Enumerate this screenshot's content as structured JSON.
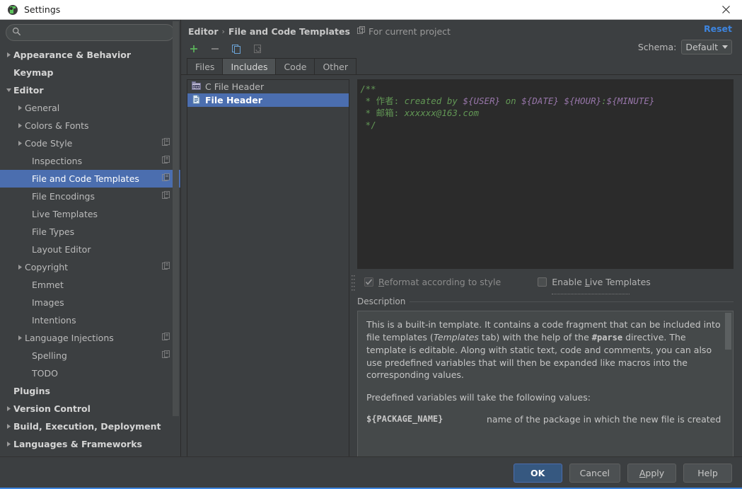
{
  "window": {
    "title": "Settings",
    "app_icon": "intellij-idea-icon",
    "close_icon": "close-icon"
  },
  "sidebar": {
    "search": {
      "value": "",
      "placeholder": "",
      "icon": "search-icon"
    },
    "items": [
      {
        "label": "Appearance & Behavior",
        "depth": 0,
        "arrow": "right",
        "bold": true,
        "copy": false,
        "selected": false
      },
      {
        "label": "Keymap",
        "depth": 0,
        "arrow": "none",
        "bold": true,
        "copy": false,
        "selected": false
      },
      {
        "label": "Editor",
        "depth": 0,
        "arrow": "down",
        "bold": true,
        "copy": false,
        "selected": false
      },
      {
        "label": "General",
        "depth": 1,
        "arrow": "right",
        "bold": false,
        "copy": false,
        "selected": false
      },
      {
        "label": "Colors & Fonts",
        "depth": 1,
        "arrow": "right",
        "bold": false,
        "copy": false,
        "selected": false
      },
      {
        "label": "Code Style",
        "depth": 1,
        "arrow": "right",
        "bold": false,
        "copy": true,
        "selected": false
      },
      {
        "label": "Inspections",
        "depth": 2,
        "arrow": "none",
        "bold": false,
        "copy": true,
        "selected": false
      },
      {
        "label": "File and Code Templates",
        "depth": 2,
        "arrow": "none",
        "bold": false,
        "copy": true,
        "selected": true
      },
      {
        "label": "File Encodings",
        "depth": 2,
        "arrow": "none",
        "bold": false,
        "copy": true,
        "selected": false
      },
      {
        "label": "Live Templates",
        "depth": 2,
        "arrow": "none",
        "bold": false,
        "copy": false,
        "selected": false
      },
      {
        "label": "File Types",
        "depth": 2,
        "arrow": "none",
        "bold": false,
        "copy": false,
        "selected": false
      },
      {
        "label": "Layout Editor",
        "depth": 2,
        "arrow": "none",
        "bold": false,
        "copy": false,
        "selected": false
      },
      {
        "label": "Copyright",
        "depth": 1,
        "arrow": "right",
        "bold": false,
        "copy": true,
        "selected": false
      },
      {
        "label": "Emmet",
        "depth": 2,
        "arrow": "none",
        "bold": false,
        "copy": false,
        "selected": false
      },
      {
        "label": "Images",
        "depth": 2,
        "arrow": "none",
        "bold": false,
        "copy": false,
        "selected": false
      },
      {
        "label": "Intentions",
        "depth": 2,
        "arrow": "none",
        "bold": false,
        "copy": false,
        "selected": false
      },
      {
        "label": "Language Injections",
        "depth": 1,
        "arrow": "right",
        "bold": false,
        "copy": true,
        "selected": false
      },
      {
        "label": "Spelling",
        "depth": 2,
        "arrow": "none",
        "bold": false,
        "copy": true,
        "selected": false
      },
      {
        "label": "TODO",
        "depth": 2,
        "arrow": "none",
        "bold": false,
        "copy": false,
        "selected": false
      },
      {
        "label": "Plugins",
        "depth": 0,
        "arrow": "none",
        "bold": true,
        "copy": false,
        "selected": false
      },
      {
        "label": "Version Control",
        "depth": 0,
        "arrow": "right",
        "bold": true,
        "copy": false,
        "selected": false
      },
      {
        "label": "Build, Execution, Deployment",
        "depth": 0,
        "arrow": "right",
        "bold": true,
        "copy": false,
        "selected": false
      },
      {
        "label": "Languages & Frameworks",
        "depth": 0,
        "arrow": "right",
        "bold": true,
        "copy": false,
        "selected": false
      }
    ]
  },
  "header": {
    "breadcrumb_parent": "Editor",
    "breadcrumb_sep": "›",
    "breadcrumb_current": "File and Code Templates",
    "scope_label": "For current project",
    "scope_icon": "project-scope-icon",
    "reset_label": "Reset",
    "schema_label": "Schema:",
    "schema_value": "Default"
  },
  "toolbar": {
    "add_icon": "plus-icon",
    "remove_icon": "minus-icon",
    "copy_icon": "copy-icon",
    "reset_icon": "reset-template-icon"
  },
  "tabs": [
    {
      "label": "Files",
      "active": false
    },
    {
      "label": "Includes",
      "active": true
    },
    {
      "label": "Code",
      "active": false
    },
    {
      "label": "Other",
      "active": false
    }
  ],
  "template_list": [
    {
      "label": "C File Header",
      "icon": "cpp-file-icon",
      "selected": false
    },
    {
      "label": "File Header",
      "icon": "file-text-icon",
      "selected": true
    }
  ],
  "editor": {
    "lines": [
      {
        "segments": [
          {
            "text": "/**",
            "style": "comment"
          }
        ]
      },
      {
        "segments": [
          {
            "text": " * ",
            "style": "comment"
          },
          {
            "text": "作者: ",
            "style": "cjk"
          },
          {
            "text": "created by ",
            "style": "comment-italic"
          },
          {
            "text": "${USER}",
            "style": "variable"
          },
          {
            "text": " on ",
            "style": "comment-italic"
          },
          {
            "text": "${DATE}",
            "style": "variable"
          },
          {
            "text": " ",
            "style": "comment-italic"
          },
          {
            "text": "${HOUR}",
            "style": "variable"
          },
          {
            "text": ":",
            "style": "comment-italic"
          },
          {
            "text": "${MINUTE}",
            "style": "variable"
          }
        ]
      },
      {
        "segments": [
          {
            "text": " * ",
            "style": "comment"
          },
          {
            "text": "邮箱: ",
            "style": "cjk"
          },
          {
            "text": "xxxxxx@163.com",
            "style": "comment-italic"
          }
        ]
      },
      {
        "segments": [
          {
            "text": " */",
            "style": "comment"
          }
        ]
      }
    ]
  },
  "options": {
    "reformat": {
      "label_before": "R",
      "label_after": "eformat according to style",
      "checked": true,
      "disabled": true
    },
    "live_templates": {
      "label_pre": "Enable ",
      "label_mn": "L",
      "label_post": "ive Templates",
      "checked": false,
      "disabled": false
    }
  },
  "description": {
    "legend": "Description",
    "para1_a": "This is a built-in template. It contains a code fragment that can be included into file templates (",
    "para1_italic": "Templates",
    "para1_b": " tab) with the help of the ",
    "para1_bold": "#parse",
    "para1_c": " directive. The template is editable. Along with static text, code and comments, you can also use predefined variables that will then be expanded like macros into the corresponding values.",
    "para2": "Predefined variables will take the following values:",
    "var_name": "${PACKAGE_NAME}",
    "var_desc": "name of the package in which the new file is created"
  },
  "footer": {
    "ok": "OK",
    "cancel": "Cancel",
    "apply_mn": "A",
    "apply_rest": "pply",
    "help": "Help"
  },
  "colors": {
    "accent_blue": "#4b6eaf",
    "link_blue": "#3d85e0",
    "comment_green": "#629755",
    "variable_purple": "#9876aa",
    "panel_bg": "#3c3f41",
    "editor_bg": "#2b2b2b"
  }
}
